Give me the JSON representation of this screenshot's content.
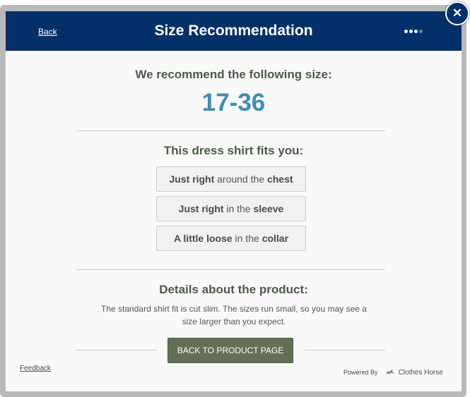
{
  "header": {
    "back_label": "Back",
    "title": "Size Recommendation",
    "progress": {
      "current": 3,
      "total": 4
    },
    "close_icon": "close-icon"
  },
  "recommendation": {
    "heading": "We recommend the following size:",
    "size": "17-36"
  },
  "fit": {
    "heading": "This dress shirt fits you:",
    "items": [
      {
        "qualifier": "Just right",
        "middle": " around the ",
        "area": "chest"
      },
      {
        "qualifier": "Just right",
        "middle": " in the ",
        "area": "sleeve"
      },
      {
        "qualifier": "A little loose",
        "middle": " in the ",
        "area": "collar"
      }
    ]
  },
  "details": {
    "heading": "Details about the product:",
    "text": "The standard shirt fit is cut slim. The sizes run small, so you may see a size larger than you expect."
  },
  "cta": {
    "label": "BACK TO PRODUCT PAGE"
  },
  "footer": {
    "feedback_label": "Feedback",
    "powered_by": "Powered By",
    "brand": "Clothes Horse",
    "brand_icon": "horse-icon"
  },
  "colors": {
    "header_bg": "#04306a",
    "size_accent": "#3d8db7",
    "button_bg": "#646f55"
  }
}
